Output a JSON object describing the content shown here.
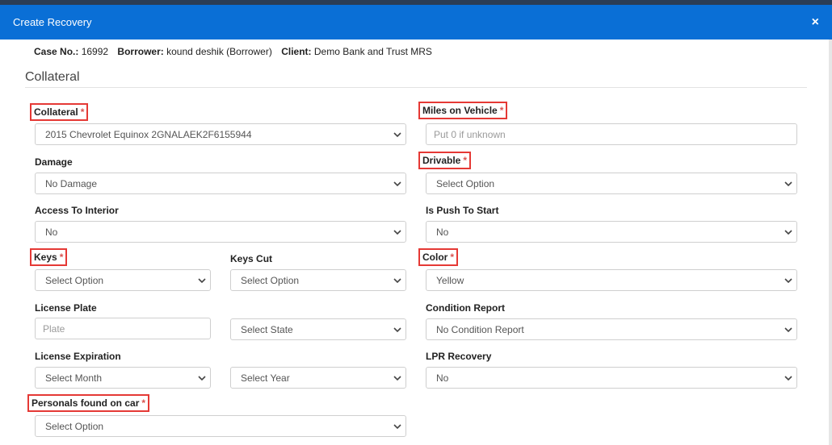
{
  "modal": {
    "title": "Create Recovery",
    "close_label": "×"
  },
  "case": {
    "case_no_label": "Case No.:",
    "case_no": "16992",
    "borrower_label": "Borrower:",
    "borrower": "kound deshik (Borrower)",
    "client_label": "Client:",
    "client": "Demo Bank and Trust MRS"
  },
  "section": {
    "title": "Collateral"
  },
  "fields": {
    "collateral": {
      "label": "Collateral",
      "required": "*",
      "value": "2015 Chevrolet Equinox 2GNALAEK2F6155944"
    },
    "miles": {
      "label": "Miles on Vehicle",
      "required": "*",
      "placeholder": "Put 0 if unknown"
    },
    "damage": {
      "label": "Damage",
      "value": "No Damage"
    },
    "drivable": {
      "label": "Drivable",
      "required": "*",
      "value": "Select Option"
    },
    "access_interior": {
      "label": "Access To Interior",
      "value": "No"
    },
    "push_to_start": {
      "label": "Is Push To Start",
      "value": "No"
    },
    "keys": {
      "label": "Keys",
      "required": "*",
      "value": "Select Option"
    },
    "keys_cut": {
      "label": "Keys Cut",
      "value": "Select Option"
    },
    "color": {
      "label": "Color",
      "required": "*",
      "value": "Yellow"
    },
    "license_plate": {
      "label": "License Plate",
      "placeholder": "Plate"
    },
    "plate_state": {
      "value": "Select State"
    },
    "condition_report": {
      "label": "Condition Report",
      "value": "No Condition Report"
    },
    "license_expiration": {
      "label": "License Expiration"
    },
    "exp_month": {
      "value": "Select Month"
    },
    "exp_year": {
      "value": "Select Year"
    },
    "lpr_recovery": {
      "label": "LPR Recovery",
      "value": "No"
    },
    "personals": {
      "label": "Personals found on car",
      "required": "*",
      "value": "Select Option"
    }
  },
  "colors": {
    "header": "#0a6fd6",
    "required": "#d9534f",
    "highlight": "#e53935"
  }
}
